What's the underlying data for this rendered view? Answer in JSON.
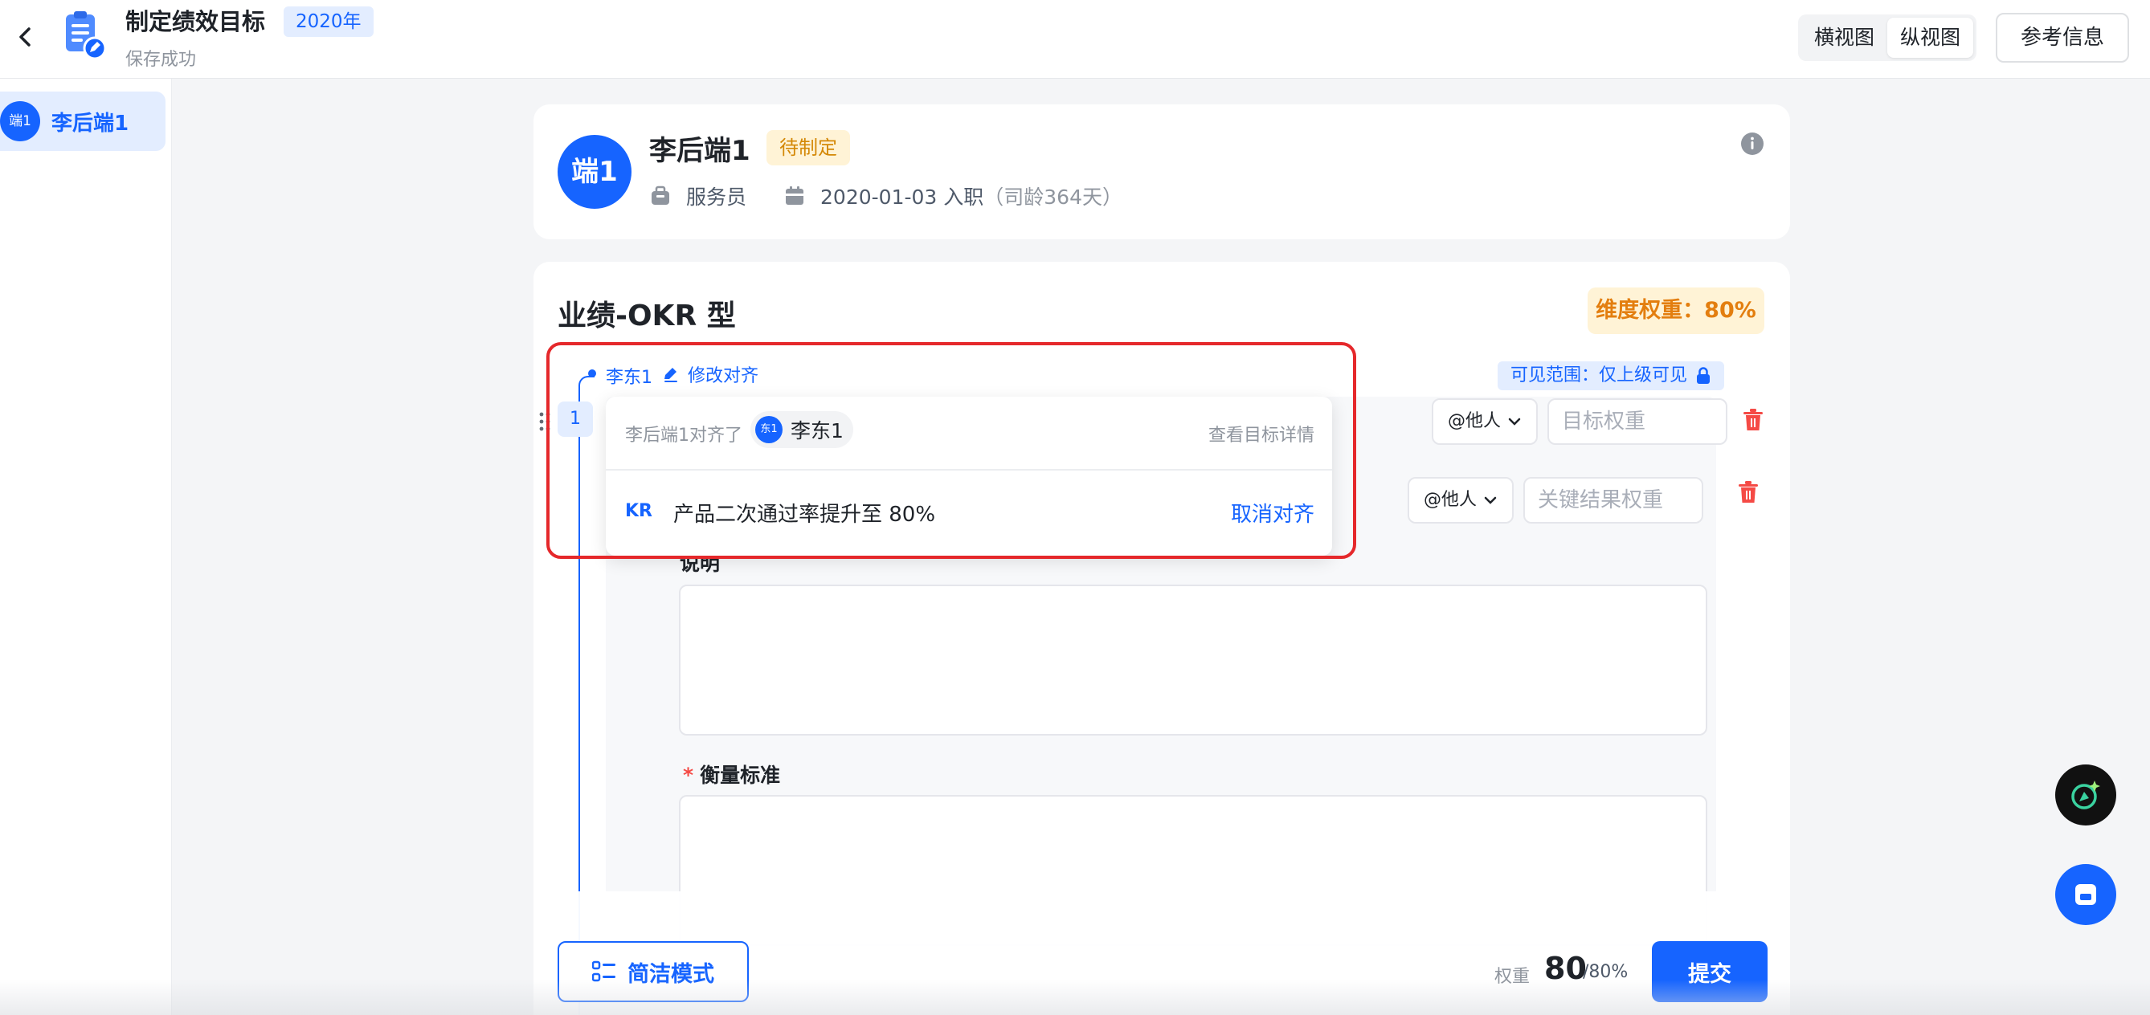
{
  "header": {
    "title": "制定绩效目标",
    "year_tag": "2020年",
    "save_status": "保存成功",
    "view_options": [
      "横视图",
      "纵视图"
    ],
    "active_view": "纵视图",
    "reference_button": "参考信息"
  },
  "sidebar": {
    "items": [
      {
        "avatar": "端1",
        "label": "李后端1",
        "selected": true
      }
    ]
  },
  "profile": {
    "avatar": "端1",
    "name": "李后端1",
    "status": "待制定",
    "position": "服务员",
    "join_date": "2020-01-03 入职",
    "tenure": "（司龄364天）"
  },
  "goal_section": {
    "title": "业绩-OKR 型",
    "dimension_weight": "维度权重：80%",
    "aligned_owner": "李东1",
    "edit_alignment": "修改对齐",
    "visibility": "可见范围：仅上级可见",
    "row_number": "1",
    "objective": {
      "mention_label": "@他人",
      "weight_placeholder": "目标权重"
    },
    "key_result": {
      "mention_label": "@他人",
      "weight_placeholder": "关键结果权重"
    },
    "description_label": "说明",
    "criteria_label": "衡量标准",
    "criteria_required_mark": "*"
  },
  "alignment_popover": {
    "aligned_text": "李后端1对齐了",
    "person_avatar": "东1",
    "person_name": "李东1",
    "view_detail": "查看目标详情",
    "kr_tag": "KR",
    "kr_text": "产品二次通过率提升至 80%",
    "unalign": "取消对齐"
  },
  "footer": {
    "simple_mode": "简洁模式",
    "weight_label": "权重",
    "weight_value": "80",
    "weight_total": "/80%",
    "submit": "提交"
  },
  "colors": {
    "primary": "#1664ff",
    "warning_bg": "#fff3d6",
    "warning_text": "#e37e0f",
    "danger": "#f54a45",
    "highlight": "#e5282b"
  },
  "icons": {
    "back": "chevron-left-icon",
    "app": "document-edit-icon",
    "info": "info-icon",
    "briefcase": "briefcase-icon",
    "calendar": "calendar-icon",
    "edit": "pencil-icon",
    "lock": "lock-icon",
    "trash": "trash-icon",
    "list": "list-icon",
    "ai": "ai-assistant-icon",
    "chat": "chat-icon"
  }
}
